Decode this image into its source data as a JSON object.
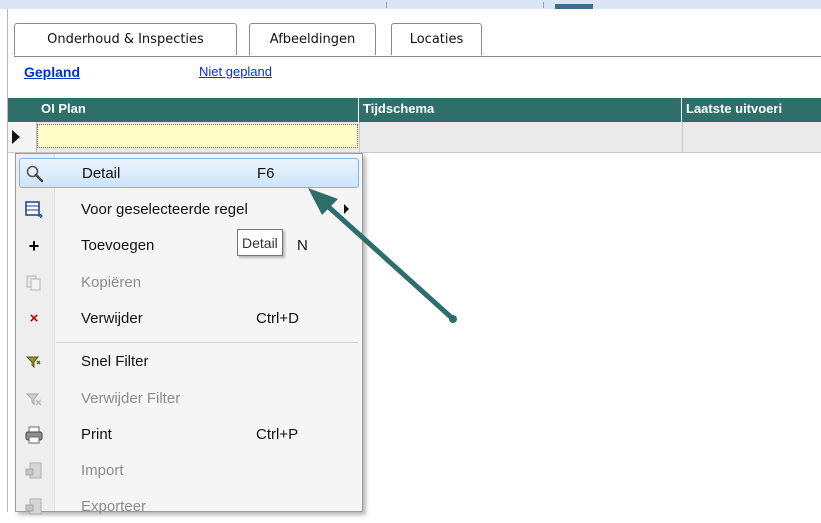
{
  "tabs": [
    {
      "label": "Onderhoud & Inspecties"
    },
    {
      "label": "Afbeeldingen"
    },
    {
      "label": "Locaties"
    }
  ],
  "filter_tabs": {
    "planned": "Gepland",
    "unplanned": "Niet gepland"
  },
  "grid": {
    "columns": [
      {
        "label": "OI Plan"
      },
      {
        "label": "Tijdschema"
      },
      {
        "label": "Laatste uitvoeri"
      }
    ]
  },
  "context_menu": {
    "items": [
      {
        "label": "Detail",
        "shortcut": "F6",
        "icon": "magnifier-icon"
      },
      {
        "label": "Voor geselecteerde regel",
        "shortcut": "",
        "icon": "table-row-icon"
      },
      {
        "label": "Toevoegen",
        "shortcut": "N",
        "icon": "plus-icon"
      },
      {
        "label": "Kopiëren",
        "shortcut": "",
        "icon": "copy-icon"
      },
      {
        "label": "Verwijder",
        "shortcut": "Ctrl+D",
        "icon": "delete-x-icon"
      },
      {
        "label": "Snel Filter",
        "shortcut": "",
        "icon": "filter-icon"
      },
      {
        "label": "Verwijder Filter",
        "shortcut": "",
        "icon": "remove-filter-icon"
      },
      {
        "label": "Print",
        "shortcut": "Ctrl+P",
        "icon": "printer-icon"
      },
      {
        "label": "Import",
        "shortcut": "",
        "icon": "import-icon"
      },
      {
        "label": "Exporteer",
        "shortcut": "",
        "icon": "export-icon"
      }
    ]
  },
  "tooltip": {
    "text": "Detail"
  },
  "colors": {
    "grid_header": "#2f6f6a",
    "menu_highlight": "#cde4f8",
    "link": "#0033cc",
    "arrow": "#2e6e6a"
  }
}
